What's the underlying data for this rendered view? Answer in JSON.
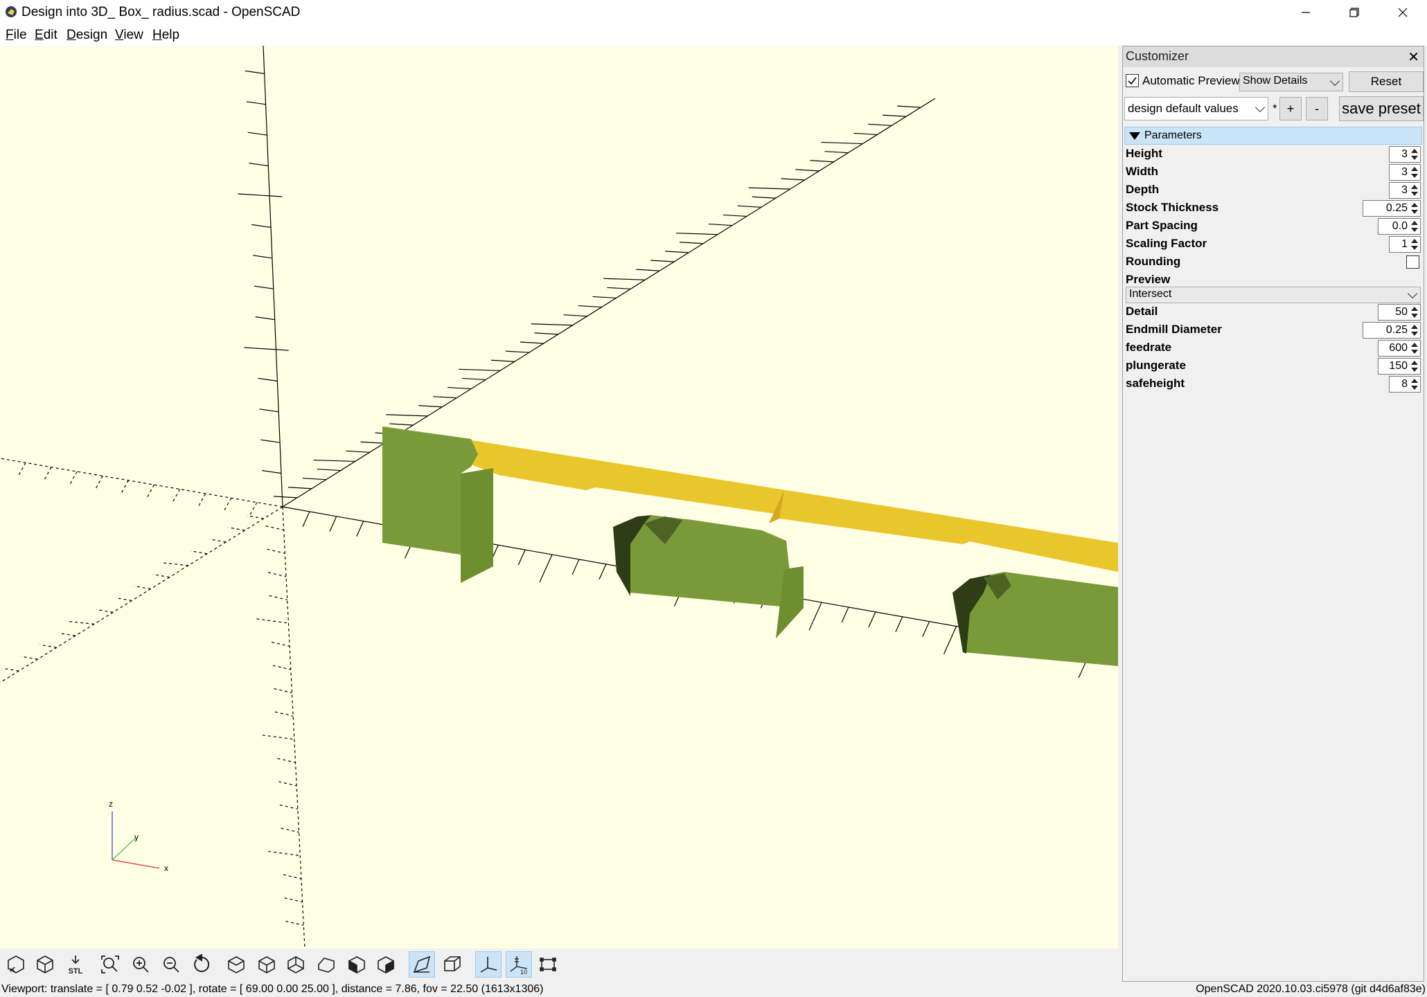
{
  "window": {
    "title": "Design into 3D_ Box_ radius.scad - OpenSCAD"
  },
  "menu": {
    "items": [
      {
        "first": "F",
        "rest": "ile"
      },
      {
        "first": "E",
        "rest": "dit"
      },
      {
        "first": "D",
        "rest": "esign"
      },
      {
        "first": "V",
        "rest": "iew"
      },
      {
        "first": "H",
        "rest": "elp"
      }
    ]
  },
  "customizer": {
    "title": "Customizer",
    "automatic_preview_label": "Automatic Preview",
    "automatic_preview_checked": true,
    "details_mode": "Show Details",
    "reset_label": "Reset",
    "preset": "design default values",
    "preset_modified_marker": "*",
    "plus_label": "+",
    "minus_label": "-",
    "save_preset_label": "save preset",
    "section_label": "Parameters",
    "params": [
      {
        "label": "Height",
        "value": "3"
      },
      {
        "label": "Width",
        "value": "3"
      },
      {
        "label": "Depth",
        "value": "3"
      },
      {
        "label": "Stock Thickness",
        "value": "0.25"
      },
      {
        "label": "Part Spacing",
        "value": "0.0"
      },
      {
        "label": "Scaling Factor",
        "value": "1"
      }
    ],
    "rounding_label": "Rounding",
    "rounding_checked": false,
    "preview_label": "Preview",
    "preview_value": "Intersect",
    "params2": [
      {
        "label": "Detail",
        "value": "50"
      },
      {
        "label": "Endmill Diameter",
        "value": "0.25"
      },
      {
        "label": "feedrate",
        "value": "600"
      },
      {
        "label": "plungerate",
        "value": "150"
      },
      {
        "label": "safeheight",
        "value": "8"
      }
    ]
  },
  "viewport": {
    "background": "#ffffe5",
    "model_top_color": "#e9c62b",
    "model_side_color": "#7a9a3a",
    "axis_labels": {
      "z": "z",
      "y": "y",
      "x": "x"
    }
  },
  "toolbar": {
    "icons": [
      "render-cube-icon",
      "preview-cube-icon",
      "export-stl-icon",
      "view-all-icon",
      "zoom-in-icon",
      "zoom-out-icon",
      "reset-view-icon",
      "view-right-icon",
      "view-top-icon",
      "view-bottom-icon",
      "view-left-icon",
      "view-front-icon",
      "view-back-icon",
      "perspective-icon",
      "orthogonal-icon",
      "show-axes-icon",
      "show-scale-markers-icon",
      "show-edges-icon"
    ],
    "stl_label": "STL",
    "scale_label": "10"
  },
  "status": {
    "viewport_info": "Viewport: translate = [ 0.79 0.52 -0.02 ], rotate = [ 69.00 0.00 25.00 ], distance = 7.86, fov = 22.50 (1613x1306)",
    "version": "OpenSCAD 2020.10.03.ci5978 (git d4d6af83e)"
  }
}
